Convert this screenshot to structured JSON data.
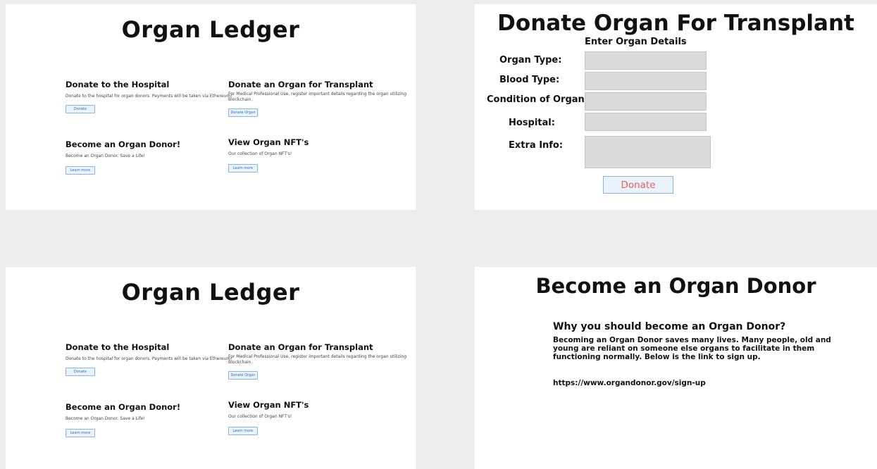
{
  "ledger": {
    "title": "Organ Ledger",
    "donate_hospital": {
      "heading": "Donate to the Hospital",
      "text": "Donate to the hospital for organ donors. Payments will be taken via Ethereum!",
      "button": "Donate"
    },
    "donate_transplant": {
      "heading": "Donate an Organ for Transplant",
      "text": "For Medical Professional Use, register important details regarding the organ utilizing Blockchain.",
      "button": "Donate Organ"
    },
    "become_donor": {
      "heading": "Become an Organ Donor!",
      "text": "Become an Organ Donor. Save a Life!",
      "button": "Learn more"
    },
    "view_nfts": {
      "heading": "View Organ NFT's",
      "text": "Our collection of Organ NFT's!",
      "button": "Learn more"
    }
  },
  "donate_form": {
    "title": "Donate Organ For Transplant",
    "subtitle": "Enter Organ Details",
    "labels": {
      "organ_type": "Organ Type:",
      "blood_type": "Blood Type:",
      "condition": "Condition of Organ:",
      "hospital": "Hospital:",
      "extra_info": "Extra Info:"
    },
    "submit_label": "Donate"
  },
  "donor_info": {
    "title": "Become an Organ Donor",
    "question": "Why you should become an Organ Donor?",
    "body": "Becoming an Organ Donor saves many lives. Many people, old and young are reliant on someone else organs to facilitate in them functioning normally. Below is the link to sign up.",
    "link": "https://www.organdonor.gov/sign-up"
  }
}
